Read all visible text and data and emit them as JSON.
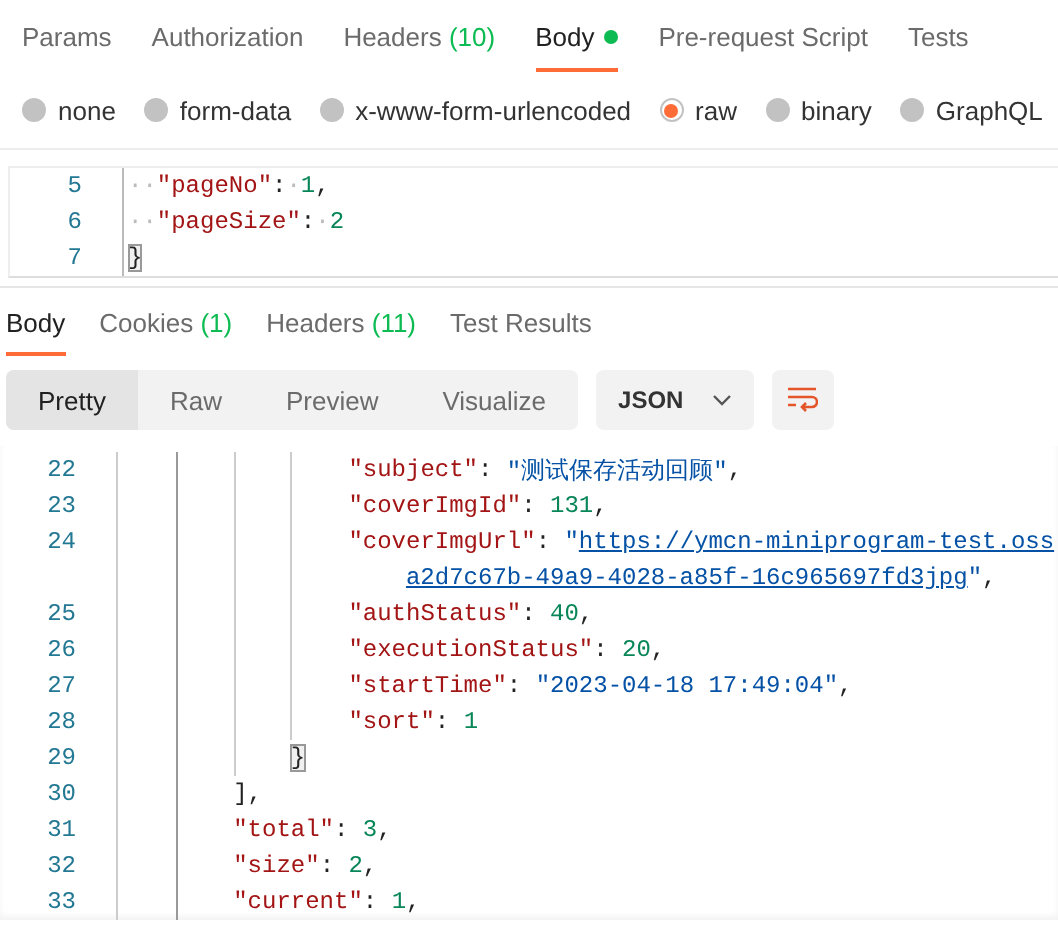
{
  "request_tabs": [
    {
      "label": "Params",
      "selected": false
    },
    {
      "label": "Authorization",
      "selected": false
    },
    {
      "label": "Headers",
      "count": "(10)",
      "selected": false
    },
    {
      "label": "Body",
      "selected": true,
      "has_content": true
    },
    {
      "label": "Pre-request Script",
      "selected": false
    },
    {
      "label": "Tests",
      "selected": false
    }
  ],
  "body_types": [
    {
      "label": "none",
      "selected": false
    },
    {
      "label": "form-data",
      "selected": false
    },
    {
      "label": "x-www-form-urlencoded",
      "selected": false
    },
    {
      "label": "raw",
      "selected": true
    },
    {
      "label": "binary",
      "selected": false
    },
    {
      "label": "GraphQL",
      "selected": false
    }
  ],
  "request_editor": {
    "lines": [
      {
        "number": "5",
        "tokens": [
          {
            "kind": "ws",
            "text": "··"
          },
          {
            "kind": "key",
            "text": "\"pageNo\""
          },
          {
            "kind": "punct",
            "text": ":"
          },
          {
            "kind": "ws",
            "text": "·"
          },
          {
            "kind": "number",
            "text": "1"
          },
          {
            "kind": "punct",
            "text": ","
          }
        ]
      },
      {
        "number": "6",
        "tokens": [
          {
            "kind": "ws",
            "text": "··"
          },
          {
            "kind": "key",
            "text": "\"pageSize\""
          },
          {
            "kind": "punct",
            "text": ":"
          },
          {
            "kind": "ws",
            "text": "·"
          },
          {
            "kind": "number",
            "text": "2"
          }
        ]
      },
      {
        "number": "7",
        "tokens": [
          {
            "kind": "bracket",
            "text": "}"
          }
        ]
      }
    ]
  },
  "response_tabs": [
    {
      "label": "Body",
      "selected": true
    },
    {
      "label": "Cookies",
      "count": "(1)",
      "selected": false
    },
    {
      "label": "Headers",
      "count": "(11)",
      "selected": false
    },
    {
      "label": "Test Results",
      "selected": false
    }
  ],
  "view_modes": [
    {
      "label": "Pretty",
      "selected": true
    },
    {
      "label": "Raw",
      "selected": false
    },
    {
      "label": "Preview",
      "selected": false
    },
    {
      "label": "Visualize",
      "selected": false
    }
  ],
  "format": "JSON",
  "response_editor": {
    "lines": [
      {
        "children": [
          {
            "children": [
              {
                "number": "22",
                "tokens": [
                  {
                    "kind": "key",
                    "text": "\"subject\""
                  },
                  {
                    "kind": "punct",
                    "text": ": "
                  },
                  {
                    "kind": "string",
                    "text": "\"测试保存活动回顾\""
                  },
                  {
                    "kind": "punct",
                    "text": ","
                  }
                ]
              },
              {
                "number": "23",
                "tokens": [
                  {
                    "kind": "key",
                    "text": "\"coverImgId\""
                  },
                  {
                    "kind": "punct",
                    "text": ": "
                  },
                  {
                    "kind": "number",
                    "text": "131"
                  },
                  {
                    "kind": "punct",
                    "text": ","
                  }
                ]
              },
              {
                "number": "24",
                "tokens": [
                  {
                    "kind": "key",
                    "text": "\"coverImgUrl\""
                  },
                  {
                    "kind": "punct",
                    "text": ": "
                  },
                  {
                    "kind": "string",
                    "text": "\""
                  },
                  {
                    "kind": "link",
                    "text": "https://ymcn-miniprogram-test.oss"
                  }
                ],
                "continuation": [
                  {
                    "kind": "link",
                    "text": "a2d7c67b-49a9-4028-a85f-16c965697fd3jpg"
                  },
                  {
                    "kind": "string",
                    "text": "\""
                  },
                  {
                    "kind": "punct",
                    "text": ","
                  }
                ]
              },
              {
                "number": "25",
                "tokens": [
                  {
                    "kind": "key",
                    "text": "\"authStatus\""
                  },
                  {
                    "kind": "punct",
                    "text": ": "
                  },
                  {
                    "kind": "number",
                    "text": "40"
                  },
                  {
                    "kind": "punct",
                    "text": ","
                  }
                ]
              },
              {
                "number": "26",
                "tokens": [
                  {
                    "kind": "key",
                    "text": "\"executionStatus\""
                  },
                  {
                    "kind": "punct",
                    "text": ": "
                  },
                  {
                    "kind": "number",
                    "text": "20"
                  },
                  {
                    "kind": "punct",
                    "text": ","
                  }
                ]
              },
              {
                "number": "27",
                "tokens": [
                  {
                    "kind": "key",
                    "text": "\"startTime\""
                  },
                  {
                    "kind": "punct",
                    "text": ": "
                  },
                  {
                    "kind": "string",
                    "text": "\"2023-04-18 17:49:04\""
                  },
                  {
                    "kind": "punct",
                    "text": ","
                  }
                ]
              },
              {
                "number": "28",
                "tokens": [
                  {
                    "kind": "key",
                    "text": "\"sort\""
                  },
                  {
                    "kind": "punct",
                    "text": ": "
                  },
                  {
                    "kind": "number",
                    "text": "1"
                  }
                ]
              }
            ]
          },
          {
            "number": "29",
            "tokens": [
              {
                "kind": "bracket",
                "text": "}"
              }
            ]
          }
        ]
      },
      {
        "number": "30",
        "tokens": [
          {
            "kind": "punct",
            "text": "]"
          },
          {
            "kind": "punct",
            "text": ","
          }
        ]
      },
      {
        "number": "31",
        "tokens": [
          {
            "kind": "key",
            "text": "\"total\""
          },
          {
            "kind": "punct",
            "text": ": "
          },
          {
            "kind": "number",
            "text": "3"
          },
          {
            "kind": "punct",
            "text": ","
          }
        ]
      },
      {
        "number": "32",
        "tokens": [
          {
            "kind": "key",
            "text": "\"size\""
          },
          {
            "kind": "punct",
            "text": ": "
          },
          {
            "kind": "number",
            "text": "2"
          },
          {
            "kind": "punct",
            "text": ","
          }
        ]
      },
      {
        "number": "33",
        "tokens": [
          {
            "kind": "key",
            "text": "\"current\""
          },
          {
            "kind": "punct",
            "text": ": "
          },
          {
            "kind": "number",
            "text": "1"
          },
          {
            "kind": "punct",
            "text": ","
          }
        ]
      }
    ]
  }
}
